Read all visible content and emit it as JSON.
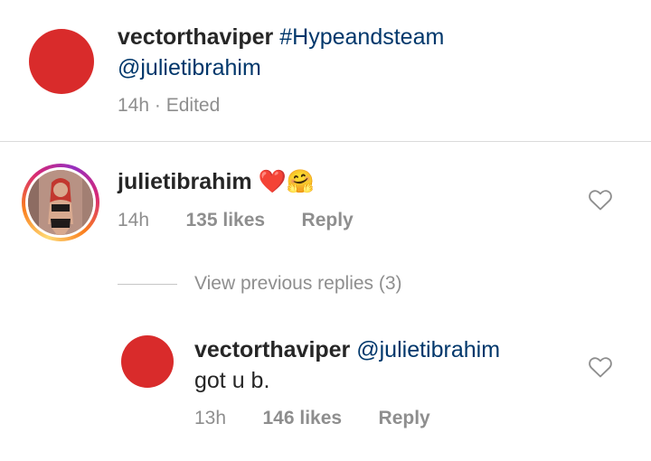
{
  "post": {
    "username": "vectorthaviper",
    "hashtag": "#Hypeandsteam",
    "mention": "@julietibrahim",
    "time": "14h",
    "separator": "·",
    "edited": "Edited"
  },
  "comment": {
    "username": "julietibrahim",
    "emoji": "❤️🤗",
    "time": "14h",
    "likes": "135 likes",
    "reply_label": "Reply"
  },
  "view_replies": {
    "label": "View previous replies (3)"
  },
  "reply": {
    "username": "vectorthaviper",
    "mention": "@julietibrahim",
    "text": "got u b.",
    "time": "13h",
    "likes": "146 likes",
    "reply_label": "Reply"
  },
  "colors": {
    "avatar_red": "#d92b2b",
    "link_blue": "#00376b",
    "meta_gray": "#8e8e8e"
  }
}
